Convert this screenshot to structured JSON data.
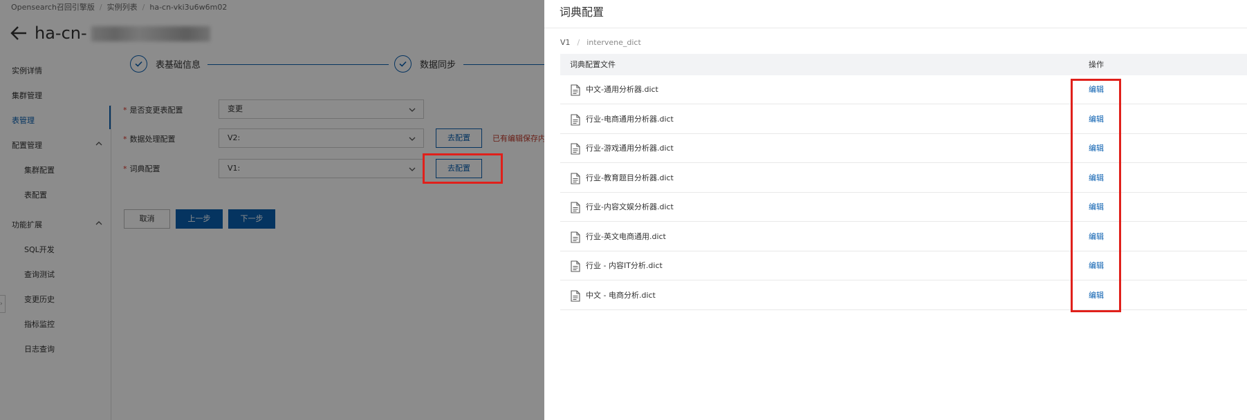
{
  "breadcrumb": [
    "Opensearch召回引擎版",
    "实例列表",
    "ha-cn-vki3u6w6m02"
  ],
  "page_title_prefix": "ha-cn-",
  "side_nav": [
    {
      "label": "实例详情",
      "active": false
    },
    {
      "label": "集群管理",
      "active": false
    },
    {
      "label": "表管理",
      "active": true
    },
    {
      "label": "配置管理",
      "active": false,
      "expandable": true
    },
    {
      "label": "集群配置",
      "active": false,
      "sub": true
    },
    {
      "label": "表配置",
      "active": false,
      "sub": true
    },
    {
      "label": "功能扩展",
      "active": false,
      "expandable": true
    },
    {
      "label": "SQL开发",
      "active": false,
      "sub": true
    },
    {
      "label": "查询测试",
      "active": false,
      "sub": true
    },
    {
      "label": "变更历史",
      "active": false,
      "sub": true
    },
    {
      "label": "指标监控",
      "active": false,
      "sub": true
    },
    {
      "label": "日志查询",
      "active": false,
      "sub": true
    }
  ],
  "steps": [
    "表基础信息",
    "数据同步"
  ],
  "form": {
    "change_config": {
      "label": "是否变更表配置",
      "value": "变更"
    },
    "data_process": {
      "label": "数据处理配置",
      "value": "V2:",
      "button": "去配置",
      "warning": "已有编辑保存内"
    },
    "dict_config": {
      "label": "词典配置",
      "value": "V1:",
      "button": "去配置"
    }
  },
  "buttons": {
    "cancel": "取消",
    "prev": "上一步",
    "next": "下一步"
  },
  "drawer": {
    "title": "词典配置",
    "breadcrumb": [
      "V1",
      "intervene_dict"
    ],
    "columns": [
      "词典配置文件",
      "操作"
    ],
    "rows": [
      {
        "file": "中文-通用分析器.dict",
        "action": "编辑"
      },
      {
        "file": "行业-电商通用分析器.dict",
        "action": "编辑"
      },
      {
        "file": "行业-游戏通用分析器.dict",
        "action": "编辑"
      },
      {
        "file": "行业-教育题目分析器.dict",
        "action": "编辑"
      },
      {
        "file": "行业-内容文娱分析器.dict",
        "action": "编辑"
      },
      {
        "file": "行业-英文电商通用.dict",
        "action": "编辑"
      },
      {
        "file": "行业 - 内容IT分析.dict",
        "action": "编辑"
      },
      {
        "file": "中文 - 电商分析.dict",
        "action": "编辑"
      }
    ]
  },
  "colors": {
    "accent": "#0a5fb0",
    "highlight": "#e0201b",
    "warning": "#c0392b"
  }
}
